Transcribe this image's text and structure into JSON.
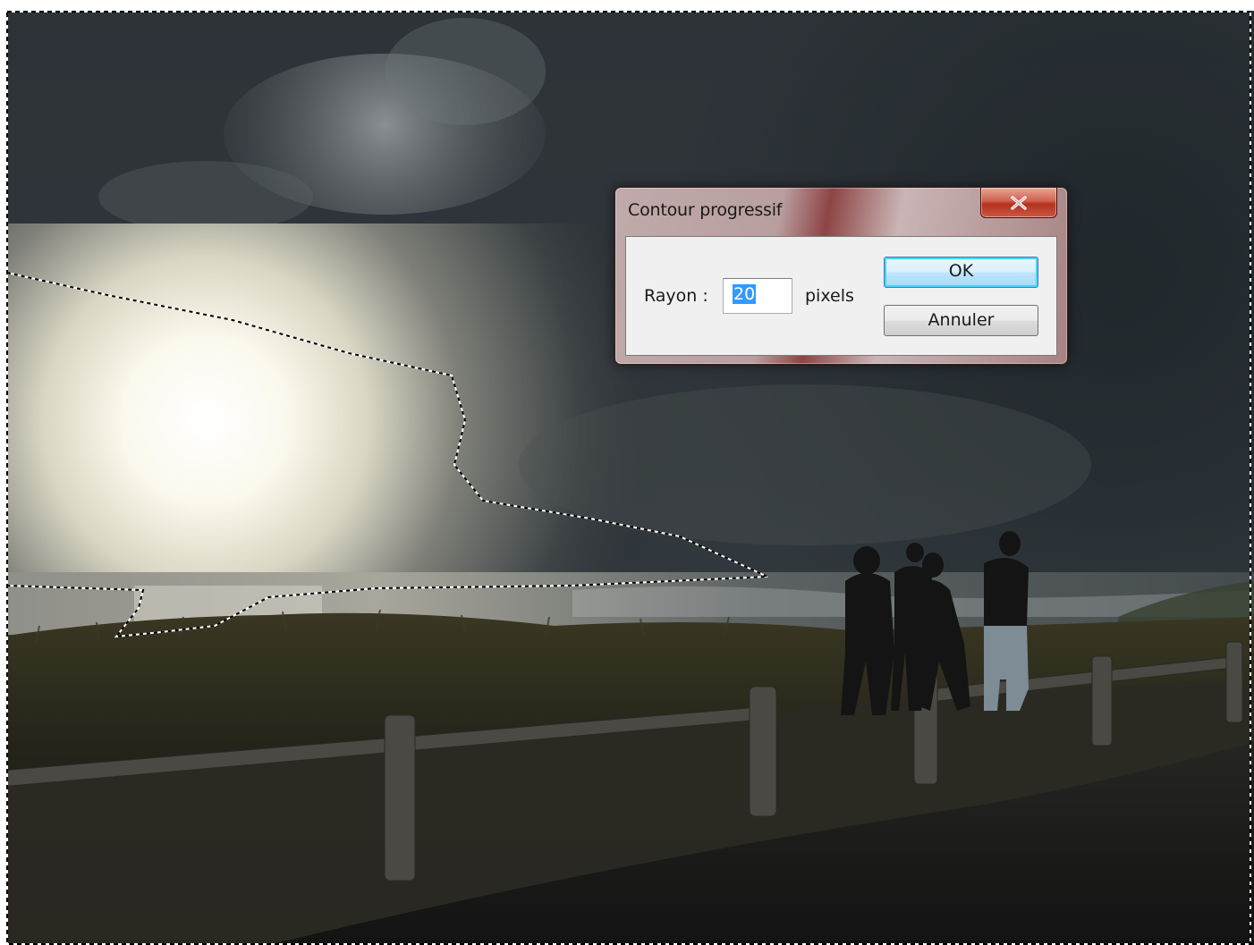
{
  "dialog": {
    "title": "Contour progressif",
    "close_glyph": "x",
    "radius_label": "Rayon :",
    "radius_value": "20",
    "unit_label": "pixels",
    "ok_label": "OK",
    "cancel_label": "Annuler"
  },
  "icons": {
    "close": "close-icon"
  },
  "colors": {
    "selection_highlight": "#3399ff",
    "ok_focus_ring": "#48d2fb",
    "close_button_red": "#c0392b",
    "dialog_frame_tint": "#b06060"
  }
}
